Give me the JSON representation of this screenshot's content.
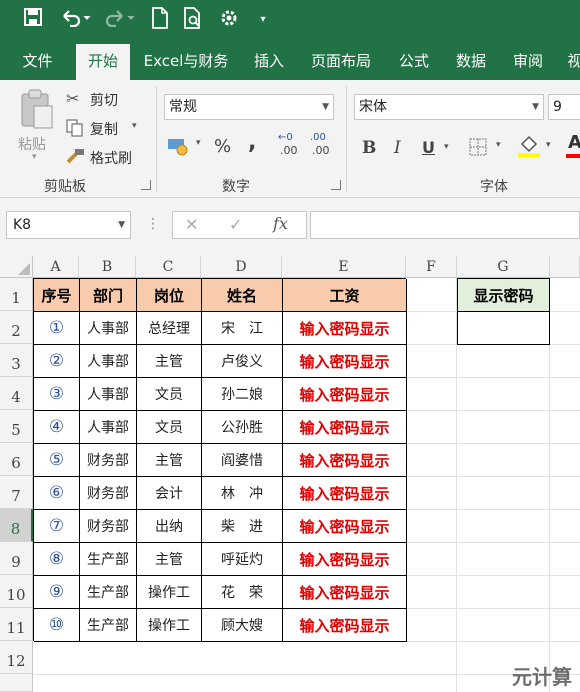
{
  "ribbon_tabs": [
    "文件",
    "开始",
    "Excel与财务",
    "插入",
    "页面布局",
    "公式",
    "数据",
    "审阅",
    "视"
  ],
  "clipboard": {
    "paste": "粘贴",
    "cut": "剪切",
    "copy": "复制",
    "format_painter": "格式刷",
    "label": "剪贴板"
  },
  "number": {
    "format": "常规",
    "percent": "%",
    "comma": ",",
    "inc_decimal": ".00",
    "dec_decimal": ".00",
    "label": "数字"
  },
  "font": {
    "name": "宋体",
    "size": "9",
    "bold": "B",
    "italic": "I",
    "underline": "U",
    "label": "字体"
  },
  "formula_bar": {
    "name_box": "K8",
    "fx": "fx",
    "cancel": "✕",
    "enter": "✓"
  },
  "columns": [
    "A",
    "B",
    "C",
    "D",
    "E",
    "F",
    "G"
  ],
  "rows": [
    "1",
    "2",
    "3",
    "4",
    "5",
    "6",
    "7",
    "8",
    "9",
    "10",
    "11",
    "12"
  ],
  "selected_row": "8",
  "table": {
    "headers": [
      "序号",
      "部门",
      "岗位",
      "姓名",
      "工资"
    ],
    "rows": [
      {
        "no": "①",
        "dept": "人事部",
        "post": "总经理",
        "name": "宋　江",
        "salary": "输入密码显示"
      },
      {
        "no": "②",
        "dept": "人事部",
        "post": "主管",
        "name": "卢俊义",
        "salary": "输入密码显示"
      },
      {
        "no": "③",
        "dept": "人事部",
        "post": "文员",
        "name": "孙二娘",
        "salary": "输入密码显示"
      },
      {
        "no": "④",
        "dept": "人事部",
        "post": "文员",
        "name": "公孙胜",
        "salary": "输入密码显示"
      },
      {
        "no": "⑤",
        "dept": "财务部",
        "post": "主管",
        "name": "阎婆惜",
        "salary": "输入密码显示"
      },
      {
        "no": "⑥",
        "dept": "财务部",
        "post": "会计",
        "name": "林　冲",
        "salary": "输入密码显示"
      },
      {
        "no": "⑦",
        "dept": "财务部",
        "post": "出纳",
        "name": "柴　进",
        "salary": "输入密码显示"
      },
      {
        "no": "⑧",
        "dept": "生产部",
        "post": "主管",
        "name": "呼延灼",
        "salary": "输入密码显示"
      },
      {
        "no": "⑨",
        "dept": "生产部",
        "post": "操作工",
        "name": "花　荣",
        "salary": "输入密码显示"
      },
      {
        "no": "⑩",
        "dept": "生产部",
        "post": "操作工",
        "name": "顾大嫂",
        "salary": "输入密码显示"
      }
    ]
  },
  "password_box": {
    "header": "显示密码",
    "value": ""
  },
  "watermark": "元计算",
  "colors": {
    "accent": "#217346",
    "header_fill": "#f8cbad",
    "password_fill": "#e2efda",
    "salary_text": "#e00000",
    "index_text": "#2f5597"
  }
}
